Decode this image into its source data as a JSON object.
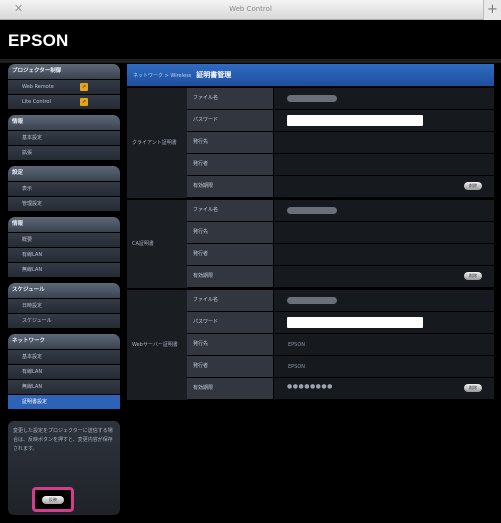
{
  "chrome": {
    "close_icon": "✕",
    "title": "Web Control",
    "plus_icon": "+"
  },
  "header": {
    "logo": "EPSON"
  },
  "sidebar": {
    "groups": [
      {
        "head": "プロジェクター制御",
        "items": [
          {
            "label": "Web Remote",
            "badge": "⇗"
          },
          {
            "label": "Lite Control",
            "badge": "⇗"
          }
        ]
      },
      {
        "head": "情報",
        "items": [
          {
            "label": "基本設定"
          },
          {
            "label": "拡張"
          }
        ]
      },
      {
        "head": "設定",
        "items": [
          {
            "label": "表示"
          },
          {
            "label": "管理設定"
          }
        ]
      },
      {
        "head": "情報",
        "items": [
          {
            "label": "概要"
          },
          {
            "label": "有線LAN"
          },
          {
            "label": "無線LAN"
          }
        ]
      },
      {
        "head": "スケジュール",
        "items": [
          {
            "label": "日時設定"
          },
          {
            "label": "スケジュール"
          }
        ]
      },
      {
        "head": "ネットワーク",
        "items": [
          {
            "label": "基本設定"
          },
          {
            "label": "有線LAN"
          },
          {
            "label": "無線LAN"
          },
          {
            "label": "証明書設定"
          }
        ]
      }
    ],
    "note": "変更した設定をプロジェクターに送信する場合は、反映ボタンを押すと、変更内容が保存されます。",
    "apply_label": "反映"
  },
  "main": {
    "breadcrumb": "ネットワーク > Wireless",
    "title": "証明書管理",
    "sections": [
      {
        "label": "クライアント証明書",
        "rows": [
          {
            "label": "ファイル名",
            "kind": "pill"
          },
          {
            "label": "パスワード",
            "kind": "input"
          },
          {
            "label": "発行先",
            "kind": "empty"
          },
          {
            "label": "発行者",
            "kind": "empty"
          },
          {
            "label": "有効期限",
            "kind": "button",
            "button": "削除"
          }
        ]
      },
      {
        "label": "CA証明書",
        "rows": [
          {
            "label": "ファイル名",
            "kind": "pill"
          },
          {
            "label": "発行先",
            "kind": "empty"
          },
          {
            "label": "発行者",
            "kind": "empty"
          },
          {
            "label": "有効期限",
            "kind": "button",
            "button": "削除"
          }
        ]
      },
      {
        "label": "Webサーバー証明書",
        "rows": [
          {
            "label": "ファイル名",
            "kind": "pill"
          },
          {
            "label": "パスワード",
            "kind": "input"
          },
          {
            "label": "発行先",
            "kind": "text",
            "value": "EPSON"
          },
          {
            "label": "発行者",
            "kind": "text",
            "value": "EPSON"
          },
          {
            "label": "有効期限",
            "kind": "dots-button",
            "value": "●●●●●●●●",
            "button": "削除"
          }
        ]
      }
    ]
  }
}
